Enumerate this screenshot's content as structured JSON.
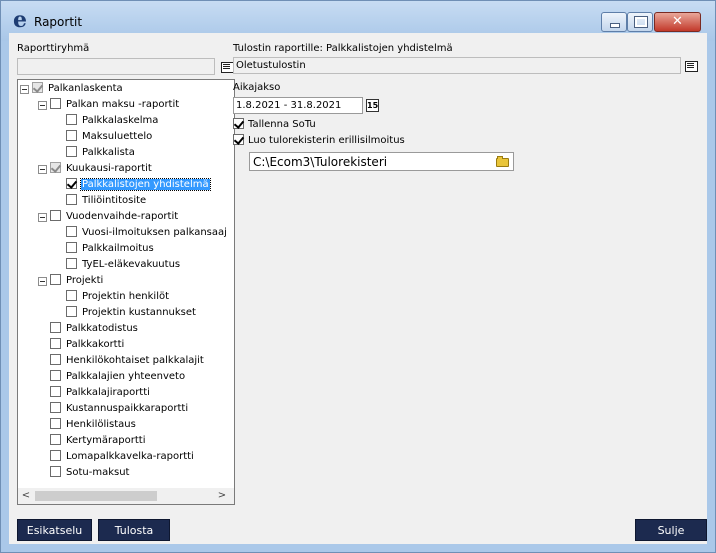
{
  "window": {
    "title": "Raportit",
    "app_icon_letter": "e"
  },
  "left": {
    "group_label": "Raporttiryhmä",
    "group_value": "",
    "tree": [
      {
        "label": "Palkanlaskenta",
        "level": 0,
        "expander": true,
        "checked": "gray"
      },
      {
        "label": "Palkan maksu -raportit",
        "level": 1,
        "expander": true,
        "checked": "none"
      },
      {
        "label": "Palkkalaskelma",
        "level": 2,
        "expander": false,
        "checked": "none"
      },
      {
        "label": "Maksuluettelo",
        "level": 2,
        "expander": false,
        "checked": "none"
      },
      {
        "label": "Palkkalista",
        "level": 2,
        "expander": false,
        "checked": "none"
      },
      {
        "label": "Kuukausi-raportit",
        "level": 1,
        "expander": true,
        "checked": "gray"
      },
      {
        "label": "Palkkalistojen yhdistelmä",
        "level": 2,
        "expander": false,
        "checked": "checked",
        "selected": true
      },
      {
        "label": "Tiliöintitosite",
        "level": 2,
        "expander": false,
        "checked": "none"
      },
      {
        "label": "Vuodenvaihde-raportit",
        "level": 1,
        "expander": true,
        "checked": "none"
      },
      {
        "label": "Vuosi-ilmoituksen palkansaaj",
        "level": 2,
        "expander": false,
        "checked": "none"
      },
      {
        "label": "Palkkailmoitus",
        "level": 2,
        "expander": false,
        "checked": "none"
      },
      {
        "label": "TyEL-eläkevakuutus",
        "level": 2,
        "expander": false,
        "checked": "none"
      },
      {
        "label": "Projekti",
        "level": 1,
        "expander": true,
        "checked": "none"
      },
      {
        "label": "Projektin henkilöt",
        "level": 2,
        "expander": false,
        "checked": "none"
      },
      {
        "label": "Projektin kustannukset",
        "level": 2,
        "expander": false,
        "checked": "none"
      },
      {
        "label": "Palkkatodistus",
        "level": 1,
        "expander": false,
        "checked": "none"
      },
      {
        "label": "Palkkakortti",
        "level": 1,
        "expander": false,
        "checked": "none"
      },
      {
        "label": "Henkilökohtaiset palkkalajit",
        "level": 1,
        "expander": false,
        "checked": "none"
      },
      {
        "label": "Palkkalajien yhteenveto",
        "level": 1,
        "expander": false,
        "checked": "none"
      },
      {
        "label": "Palkkalajiraportti",
        "level": 1,
        "expander": false,
        "checked": "none"
      },
      {
        "label": "Kustannuspaikkaraportti",
        "level": 1,
        "expander": false,
        "checked": "none"
      },
      {
        "label": "Henkilölistaus",
        "level": 1,
        "expander": false,
        "checked": "none"
      },
      {
        "label": "Kertymäraportti",
        "level": 1,
        "expander": false,
        "checked": "none"
      },
      {
        "label": "Lomapalkkavelka-raportti",
        "level": 1,
        "expander": false,
        "checked": "none"
      },
      {
        "label": "Sotu-maksut",
        "level": 1,
        "expander": false,
        "checked": "none"
      }
    ],
    "scroll_left": "<",
    "scroll_right": ">"
  },
  "right": {
    "printer_label": "Tulostin raportille: Palkkalistojen yhdistelmä",
    "printer_value": "Oletustulostin",
    "period_label": "Aikajakso",
    "period_value": "1.8.2021 - 31.8.2021",
    "calendar_icon_text": "15",
    "save_sotu_label": "Tallenna SoTu",
    "save_sotu_checked": true,
    "income_reg_label": "Luo tulorekisterin erillisilmoitus",
    "income_reg_checked": true,
    "path_value": "C:\\Ecom3\\Tulorekisteri"
  },
  "buttons": {
    "preview": "Esikatselu",
    "print": "Tulosta",
    "close": "Sulje"
  },
  "colors": {
    "button_bg": "#1c2a4f",
    "selection": "#3399ff"
  }
}
